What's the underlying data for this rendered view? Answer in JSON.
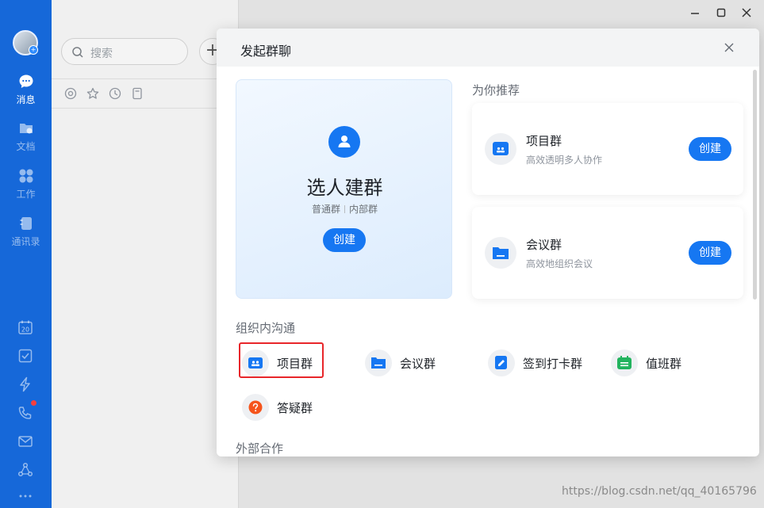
{
  "sidebar": {
    "items": [
      {
        "label": "消息",
        "icon": "message-icon"
      },
      {
        "label": "文档",
        "icon": "docs-icon"
      },
      {
        "label": "工作",
        "icon": "workspace-icon"
      },
      {
        "label": "通讯录",
        "icon": "contacts-icon"
      }
    ],
    "calendar_day": "20",
    "tools": [
      "calendar-icon",
      "todo-icon",
      "lightning-icon",
      "phone-icon",
      "mail-icon",
      "share-icon",
      "more-icon"
    ]
  },
  "list_panel": {
    "search_placeholder": "搜索"
  },
  "modal": {
    "title": "发起群聊",
    "main_card": {
      "title": "选人建群",
      "sub_1": "普通群",
      "sub_2": "内部群",
      "button": "创建"
    },
    "recommend": {
      "title": "为你推荐",
      "items": [
        {
          "name": "项目群",
          "desc": "高效透明多人协作",
          "button": "创建"
        },
        {
          "name": "会议群",
          "desc": "高效地组织会议",
          "button": "创建"
        }
      ]
    },
    "internal": {
      "title": "组织内沟通",
      "groups": [
        "项目群",
        "会议群",
        "签到打卡群",
        "值班群",
        "答疑群"
      ]
    },
    "external": {
      "title": "外部合作"
    }
  },
  "colors": {
    "brand": "#1677f2",
    "sidebar": "#1668d9",
    "highlight": "#e8262a"
  },
  "watermark": "https://blog.csdn.net/qq_40165796"
}
